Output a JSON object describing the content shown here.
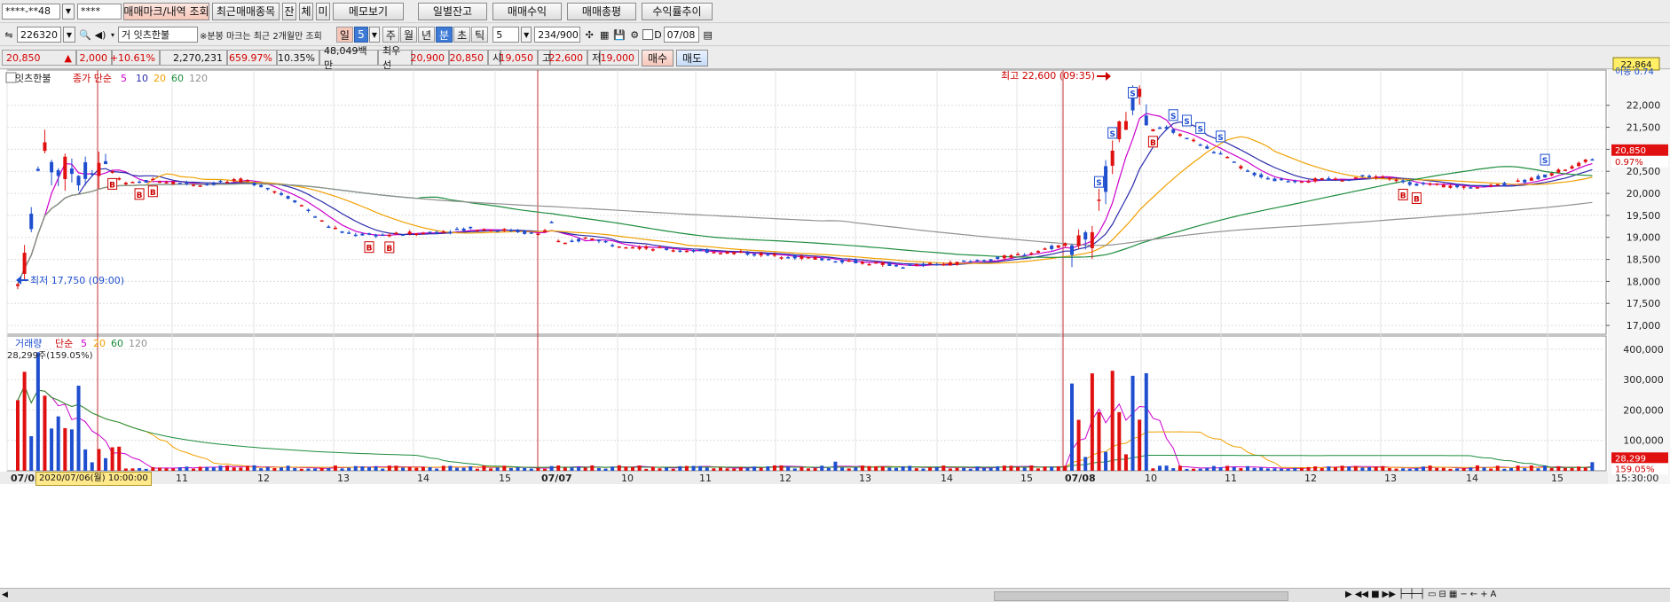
{
  "toolbar1": {
    "account": "****-**48",
    "password": "****",
    "buttons": [
      "매매마크/내역 조회",
      "최근매매종목",
      "잔",
      "체",
      "미",
      "메모보기",
      "일별잔고",
      "매매수익",
      "매매총평",
      "수익률추이"
    ]
  },
  "toolbar2": {
    "code": "226320",
    "name": "거 잇츠한불",
    "notice": "※분봉 마크는 최근 2개월만 조회",
    "periods": [
      "일",
      "5",
      "주",
      "월",
      "년",
      "분",
      "초",
      "틱"
    ],
    "interval": "5",
    "count": "234/900",
    "date": "07/08"
  },
  "quote": {
    "price": "20,850",
    "change": "2,000",
    "change_pct": "+10.61%",
    "volume": "2,270,231",
    "vol_ratio": "659.97%",
    "turnover": "10.35%",
    "amount": "48,049백만",
    "best_ask_label": "최우선",
    "best_ask": "20,900",
    "best_bid": "20,850",
    "open_label": "시",
    "open": "19,050",
    "high_label": "고",
    "high": "22,600",
    "low_label": "저",
    "low": "19,000",
    "buy": "매수",
    "sell": "매도"
  },
  "price_legend": {
    "name": "잇츠한불",
    "ma_label": "종가 단순",
    "ma": [
      "5",
      "10",
      "20",
      "60",
      "120"
    ]
  },
  "volume_legend": {
    "name": "거래량",
    "ma_label": "단순",
    "ma": [
      "5",
      "20",
      "60",
      "120"
    ],
    "current": "28,299주(159.05%)"
  },
  "annotations": {
    "high": "최고 22,600 (09:35)",
    "low": "최저 17,750 (09:00)",
    "cursor": "2020/07/06(월) 10:00:00"
  },
  "price_axis": {
    "ticks": [
      "22,000",
      "21,500",
      "21,000",
      "20,500",
      "20,000",
      "19,500",
      "19,000",
      "18,500",
      "18,000",
      "17,500",
      "17,000"
    ],
    "top_badge": "22,864",
    "ma_tag": "이동 0.74",
    "cur": "20,850",
    "pct": "0.97%"
  },
  "volume_axis": {
    "ticks": [
      "400,000",
      "300,000",
      "200,000",
      "100,000"
    ],
    "cur": "28,299",
    "pct": "159.05%"
  },
  "time_axis": {
    "labels": [
      "07/03",
      "11",
      "12",
      "13",
      "14",
      "15",
      "07/07",
      "10",
      "11",
      "12",
      "13",
      "14",
      "15",
      "07/08",
      "10",
      "11",
      "12",
      "13",
      "14",
      "15"
    ],
    "end": "15:30:00"
  },
  "colors": {
    "up": "#e01010",
    "down": "#1f4fcf",
    "ma5": "#cc00cc",
    "ma10": "#2a2aaa",
    "ma20": "#f0a000",
    "ma60": "#1c8c3c",
    "ma120": "#909090"
  },
  "chart_data": {
    "type": "candlestick",
    "interval_minutes": 5,
    "days": [
      "07/03",
      "07/06",
      "07/07",
      "07/08"
    ],
    "price_range": [
      16800,
      22800
    ],
    "ohlc_day_summary": [
      {
        "day": "07/08",
        "open": 19050,
        "high": 22600,
        "low": 19000,
        "close": 20850
      }
    ],
    "high_mark": 22600,
    "low_mark": 17750,
    "volume_range": [
      0,
      420000
    ],
    "last_volume": 28299
  }
}
